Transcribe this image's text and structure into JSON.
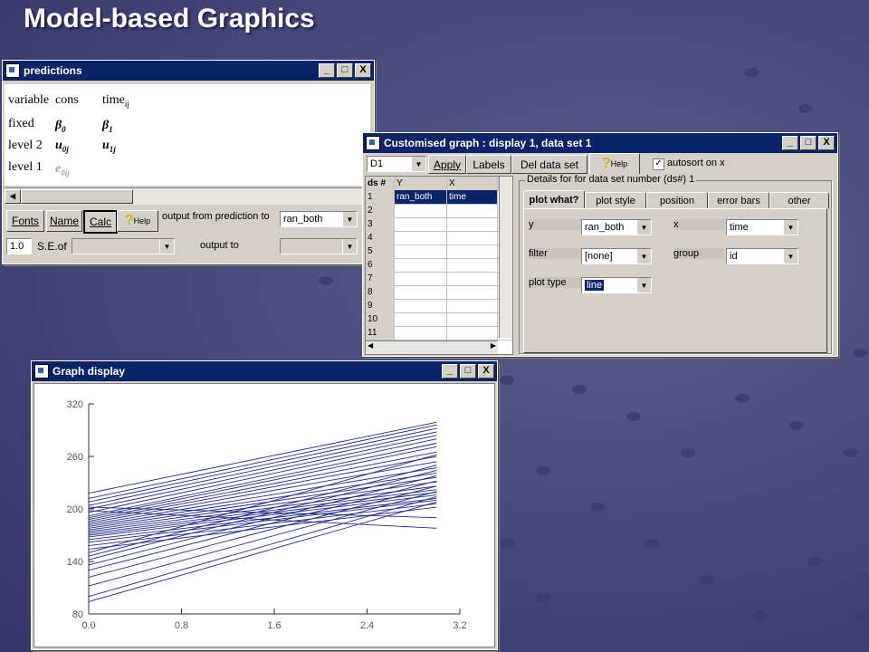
{
  "slide": {
    "title": "Model-based Graphics"
  },
  "predictions": {
    "title": "predictions",
    "win_buttons": [
      "_",
      "□",
      "X"
    ],
    "header": {
      "variable": "variable",
      "cons": "cons",
      "time": "time",
      "time_sub": "ij"
    },
    "rows": [
      {
        "label": "fixed",
        "c1": "β",
        "c1_sub": "0",
        "c2": "β",
        "c2_sub": "1"
      },
      {
        "label": "level 2",
        "c1": "u",
        "c1_sub": "0j",
        "c2": "u",
        "c2_sub": "1j"
      },
      {
        "label": "level 1",
        "c1": "e",
        "c1_sub": "0ij"
      }
    ],
    "toolbar": {
      "fonts": "Fonts",
      "name": "Name",
      "calc": "Calc",
      "help": "Help",
      "output_from": "output from prediction to",
      "output_from_value": "ran_both",
      "value": "1.0",
      "se_of": "S.E.of",
      "output_to": "output to"
    }
  },
  "custom": {
    "title": "Customised graph : display  1, data set 1",
    "display_select": "D1",
    "apply": "Apply",
    "labels": "Labels",
    "del": "Del data set",
    "help": "Help",
    "autosort": "autosort on x",
    "grid_headers": [
      "ds #",
      "Y",
      "X"
    ],
    "rows": [
      {
        "n": "1",
        "y": "ran_both",
        "x": "time"
      },
      {
        "n": "2"
      },
      {
        "n": "3"
      },
      {
        "n": "4"
      },
      {
        "n": "5"
      },
      {
        "n": "6"
      },
      {
        "n": "7"
      },
      {
        "n": "8"
      },
      {
        "n": "9"
      },
      {
        "n": "10"
      },
      {
        "n": "11"
      }
    ],
    "details_title": "Details for for data set number (ds#) 1",
    "tabs": [
      "plot what?",
      "plot style",
      "position",
      "error bars",
      "other"
    ],
    "fields": {
      "y_label": "y",
      "y_value": "ran_both",
      "x_label": "x",
      "x_value": "time",
      "filter_label": "filter",
      "filter_value": "[none]",
      "group_label": "group",
      "group_value": "id",
      "plottype_label": "plot type",
      "plottype_value": "line"
    }
  },
  "graph": {
    "title": "Graph display",
    "win_buttons": [
      "_",
      "□",
      "X"
    ]
  },
  "chart_data": {
    "type": "line",
    "xlim": [
      0.0,
      3.2
    ],
    "ylim": [
      80,
      320
    ],
    "xticks": [
      "0.0",
      "0.8",
      "1.6",
      "2.4",
      "3.2"
    ],
    "yticks": [
      "80",
      "140",
      "200",
      "260",
      "320"
    ],
    "line_color": "#1f2a8a",
    "series": [
      {
        "x": [
          0,
          3
        ],
        "y": [
          218,
          299
        ]
      },
      {
        "x": [
          0,
          3
        ],
        "y": [
          212,
          296
        ]
      },
      {
        "x": [
          0,
          3
        ],
        "y": [
          208,
          292
        ]
      },
      {
        "x": [
          0,
          3
        ],
        "y": [
          204,
          288
        ]
      },
      {
        "x": [
          0,
          3
        ],
        "y": [
          200,
          284
        ]
      },
      {
        "x": [
          0,
          3
        ],
        "y": [
          196,
          280
        ]
      },
      {
        "x": [
          0,
          3
        ],
        "y": [
          192,
          275
        ]
      },
      {
        "x": [
          0,
          3
        ],
        "y": [
          190,
          271
        ]
      },
      {
        "x": [
          0,
          3
        ],
        "y": [
          188,
          265
        ]
      },
      {
        "x": [
          0,
          3
        ],
        "y": [
          186,
          260
        ]
      },
      {
        "x": [
          0,
          3
        ],
        "y": [
          184,
          254
        ]
      },
      {
        "x": [
          0,
          3
        ],
        "y": [
          182,
          247
        ]
      },
      {
        "x": [
          0,
          3
        ],
        "y": [
          180,
          241
        ]
      },
      {
        "x": [
          0,
          3
        ],
        "y": [
          178,
          236
        ]
      },
      {
        "x": [
          0,
          3
        ],
        "y": [
          176,
          231
        ]
      },
      {
        "x": [
          0,
          3
        ],
        "y": [
          174,
          226
        ]
      },
      {
        "x": [
          0,
          3
        ],
        "y": [
          172,
          222
        ]
      },
      {
        "x": [
          0,
          3
        ],
        "y": [
          170,
          219
        ]
      },
      {
        "x": [
          0,
          3
        ],
        "y": [
          168,
          216
        ]
      },
      {
        "x": [
          0,
          3
        ],
        "y": [
          165,
          212
        ]
      },
      {
        "x": [
          0,
          3
        ],
        "y": [
          162,
          210
        ]
      },
      {
        "x": [
          0,
          3
        ],
        "y": [
          158,
          206
        ]
      },
      {
        "x": [
          0,
          3
        ],
        "y": [
          154,
          202
        ]
      },
      {
        "x": [
          0,
          3
        ],
        "y": [
          150,
          262
        ]
      },
      {
        "x": [
          0,
          3
        ],
        "y": [
          146,
          250
        ]
      },
      {
        "x": [
          0,
          3
        ],
        "y": [
          142,
          244
        ]
      },
      {
        "x": [
          0,
          3
        ],
        "y": [
          136,
          238
        ]
      },
      {
        "x": [
          0,
          3
        ],
        "y": [
          130,
          232
        ]
      },
      {
        "x": [
          0,
          3
        ],
        "y": [
          122,
          226
        ]
      },
      {
        "x": [
          0,
          3
        ],
        "y": [
          112,
          220
        ]
      },
      {
        "x": [
          0,
          3
        ],
        "y": [
          100,
          214
        ]
      },
      {
        "x": [
          0,
          3
        ],
        "y": [
          94,
          208
        ]
      },
      {
        "x": [
          0,
          3
        ],
        "y": [
          202,
          190
        ]
      },
      {
        "x": [
          0,
          3
        ],
        "y": [
          198,
          178
        ]
      }
    ]
  }
}
